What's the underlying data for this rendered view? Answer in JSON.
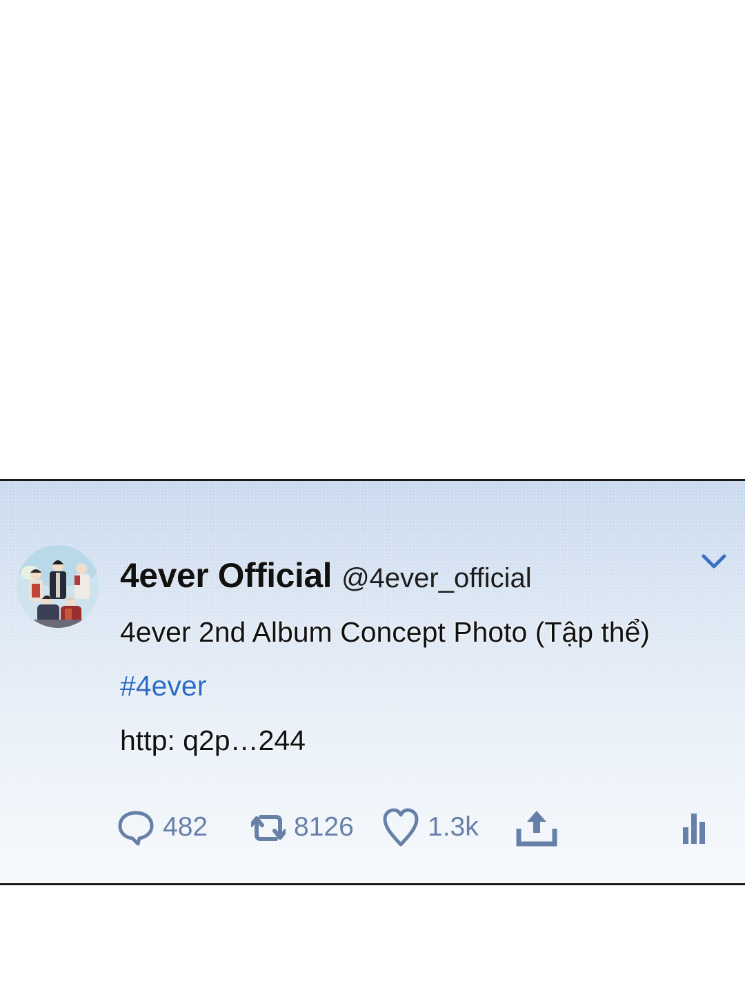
{
  "tweet": {
    "display_name": "4ever Official",
    "handle": "@4ever_official",
    "text": "4ever 2nd Album Concept Photo (Tập thể)",
    "hashtag": "#4ever",
    "link": "http: q2p…244",
    "avatar_icon": "group-illustration-avatar",
    "menu_icon": "chevron-down-icon"
  },
  "actions": {
    "reply": {
      "icon": "reply-bubble-icon",
      "count": "482"
    },
    "retweet": {
      "icon": "retweet-icon",
      "count": "8126"
    },
    "like": {
      "icon": "heart-icon",
      "count": "1.3k"
    },
    "share": {
      "icon": "share-upload-icon"
    },
    "stats": {
      "icon": "bar-chart-icon"
    }
  },
  "colors": {
    "accent": "#2c6bc4",
    "icon": "#6780a8",
    "border": "#1a1a1a"
  }
}
